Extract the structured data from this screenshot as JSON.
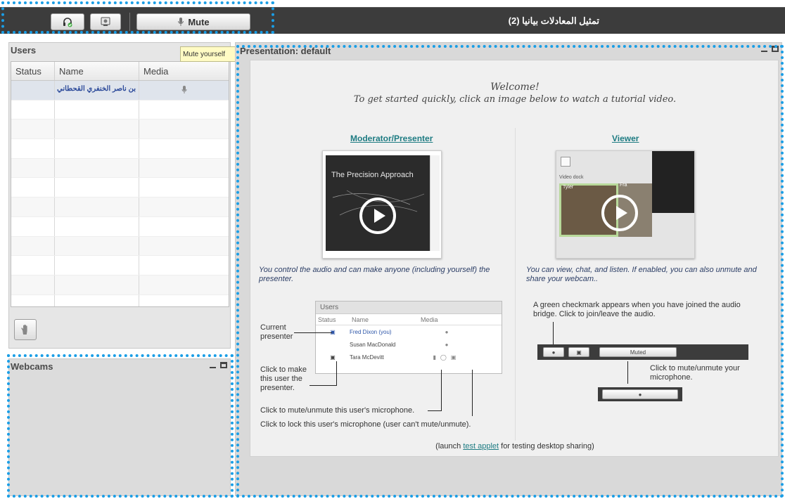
{
  "toolbar": {
    "mute_label": "Mute",
    "meeting_title": "تمثيل المعادلات بيانيا  (2)",
    "tooltip": "Mute yourself",
    "icons": [
      "headset-icon",
      "webcam-icon",
      "microphone-icon"
    ]
  },
  "users_panel": {
    "title": "Users",
    "columns": [
      "Status",
      "Name",
      "Media"
    ],
    "rows": [
      {
        "name": "بن ناصر الخنفري القحطاني",
        "media": "microphone-icon"
      }
    ],
    "raise_hand_icon": "hand-icon"
  },
  "webcams_panel": {
    "title": "Webcams"
  },
  "presentation": {
    "title": "Presentation: default",
    "welcome": "Welcome!",
    "get_started": "To get started quickly, click an image below to watch a tutorial video.",
    "moderator_heading": "Moderator/Presenter",
    "viewer_heading": "Viewer",
    "moderator_video_title": "The Precision Approach",
    "viewer_video_label": "Video dock",
    "viewer_video_names": [
      "Tyler",
      "Fra"
    ],
    "moderator_desc": "You control the audio and can make anyone (including yourself) the presenter.",
    "viewer_desc": "You can view, chat, and listen.  If enabled, you can also unmute and share your webcam..",
    "mini_users": {
      "title": "Users",
      "columns": [
        "Status",
        "Name",
        "Media"
      ],
      "rows": [
        "Fred Dixon (you)",
        "Susan MacDonald",
        "Tara McDevitt"
      ]
    },
    "current_presenter": "Current presenter",
    "click_make_presenter": "Click to make this user the presenter.",
    "click_mute": "Click to mute/unmute this user's microphone.",
    "click_lock": "Click to lock this user's microphone (user can't mute/unmute).",
    "green_checkmark": "A green checkmark appears when you have joined the audio bridge.  Click to join/leave the audio.",
    "mini_muted": "Muted",
    "click_mute_your": "Click to mute/unmute your microphone.",
    "applet_prefix": "(launch ",
    "applet_link": "test applet",
    "applet_suffix": " for testing desktop sharing)"
  }
}
